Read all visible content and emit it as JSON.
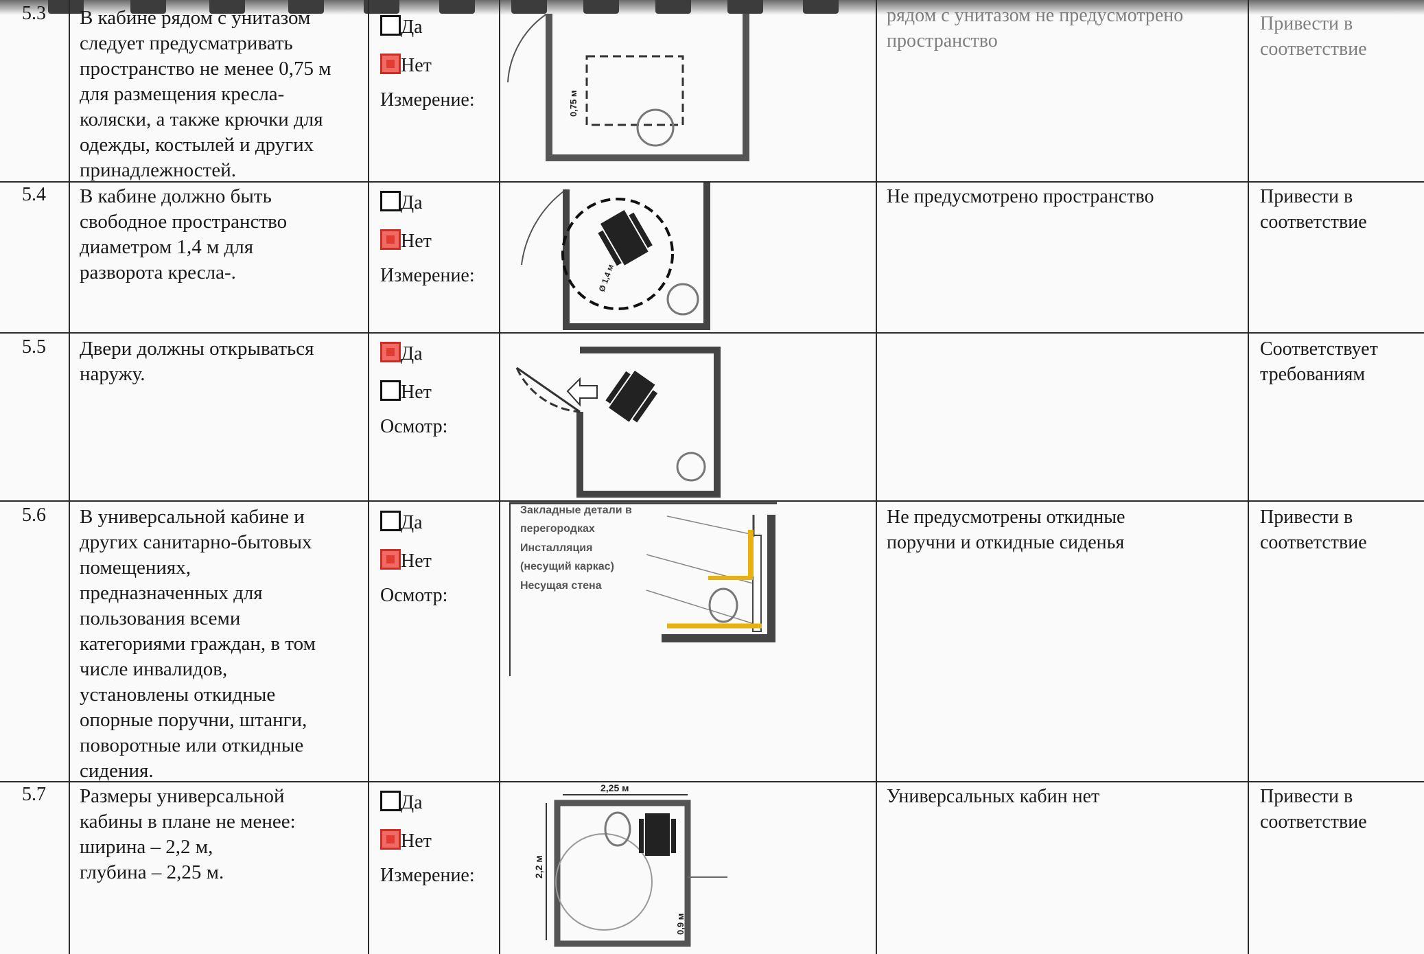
{
  "rows": [
    {
      "num": "5.3",
      "req": "В кабине рядом с унитазом\nследует предусматривать\nпространство не менее 0,75 м\nдля размещения кресла-\nколяски, а также крючки для\nодежды, костылей и других\nпринадлежностей.",
      "yes_label": "Да",
      "no_label": "Нет",
      "method": "Измерение:",
      "selected": "no",
      "note": "рядом с унитазом не предусмотрено\nпространство",
      "status": "Привести в\nсоответствие"
    },
    {
      "num": "5.4",
      "req": "В кабине должно быть\nсвободное пространство\nдиаметром 1,4 м для\nразворота кресла-.",
      "yes_label": "Да",
      "no_label": "Нет",
      "method": "Измерение:",
      "selected": "no",
      "note": "Не предусмотрено пространство",
      "status": "Привести в\nсоответствие"
    },
    {
      "num": "5.5",
      "req": "Двери должны открываться\nнаружу.",
      "yes_label": "Да",
      "no_label": "Нет",
      "method": "Осмотр:",
      "selected": "yes",
      "note": "",
      "status": "Соответствует\nтребованиям"
    },
    {
      "num": "5.6",
      "req": "В универсальной кабине и\nдругих санитарно-бытовых\nпомещениях,\nпредназначенных для\nпользования всеми\nкатегориями граждан, в том\nчисле инвалидов,\nустановлены откидные\nопорные поручни, штанги,\nповоротные или откидные\nсидения.",
      "yes_label": "Да",
      "no_label": "Нет",
      "method": "Осмотр:",
      "selected": "no",
      "note": "Не предусмотрены откидные\nпоручни и откидные сиденья",
      "status": "Привести в\nсоответствие"
    },
    {
      "num": "5.7",
      "req": "Размеры универсальной\nкабины в плане не менее:\nширина – 2,2 м,\nглубина – 2,25 м.",
      "yes_label": "Да",
      "no_label": "Нет",
      "method": "Измерение:",
      "selected": "no",
      "note": "Универсальных кабин нет",
      "status": "Привести в\nсоответствие"
    }
  ],
  "figures": {
    "f53": {
      "dim": "0,75 м"
    },
    "f54": {
      "dim": "Ø 1,4 м"
    },
    "f56": {
      "labels": [
        "Закладные детали в",
        "перегородках",
        "Инсталляция",
        "(несущий каркас)",
        "Несущая стена"
      ]
    },
    "f57": {
      "top_dim": "2,25 м",
      "side_dim": "2,2 м",
      "door_dim": "0,9 м"
    }
  },
  "colors": {
    "checked_fill": "#e23b32",
    "rail_yellow": "#e8b10f"
  }
}
